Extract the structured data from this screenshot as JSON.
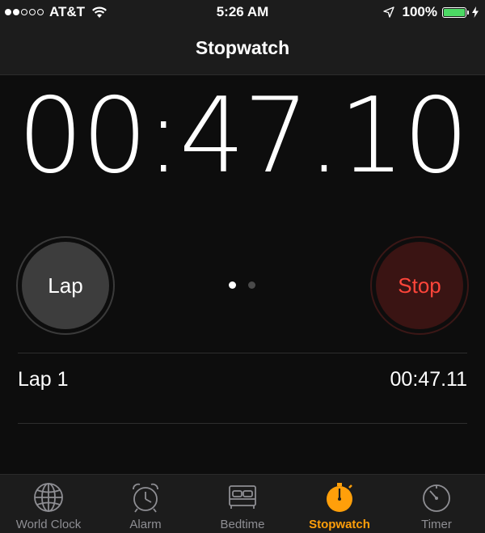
{
  "status_bar": {
    "carrier": "AT&T",
    "time": "5:26 AM",
    "battery": "100%",
    "battery_level": 1.0,
    "signal_dots": [
      true,
      true,
      false,
      false,
      false
    ],
    "icons": [
      "wifi-icon",
      "location-arrow-icon",
      "battery-icon",
      "charging-icon"
    ]
  },
  "nav": {
    "title": "Stopwatch"
  },
  "timer": {
    "display": "00:47.10"
  },
  "controls": {
    "lap_label": "Lap",
    "stop_label": "Stop",
    "page_index": 0,
    "page_count": 2
  },
  "laps": [
    {
      "name": "Lap 1",
      "time": "00:47.11"
    }
  ],
  "tabs": [
    {
      "label": "World Clock",
      "icon": "globe-icon",
      "active": false
    },
    {
      "label": "Alarm",
      "icon": "alarm-clock-icon",
      "active": false
    },
    {
      "label": "Bedtime",
      "icon": "bed-icon",
      "active": false
    },
    {
      "label": "Stopwatch",
      "icon": "stopwatch-icon",
      "active": true
    },
    {
      "label": "Timer",
      "icon": "timer-icon",
      "active": false
    }
  ],
  "colors": {
    "accent": "#ff9f0a",
    "stop_text": "#ff453a",
    "battery": "#4cd964",
    "background": "#0d0d0d"
  }
}
